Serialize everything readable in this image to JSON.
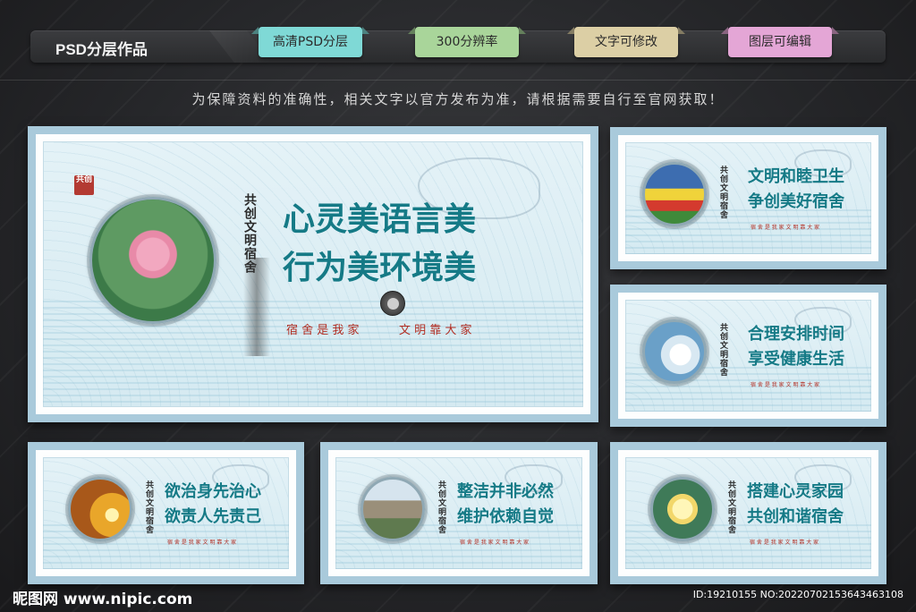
{
  "header": {
    "title": "PSD分层作品",
    "tags": [
      {
        "label": "高清PSD分层",
        "color": "#7fd9d6"
      },
      {
        "label": "300分辨率",
        "color": "#a9d59a"
      },
      {
        "label": "文字可修改",
        "color": "#dccfa5"
      },
      {
        "label": "图层可编辑",
        "color": "#e4a6d6"
      }
    ]
  },
  "notice": "为保障资料的准确性，相关文字以官方发布为准，请根据需要自行至官网获取！",
  "panels": {
    "main": {
      "seal": "共创",
      "vertical": "共创文明宿舍",
      "line1": "心灵美语言美",
      "line2": "行为美环境美",
      "motto_left": "宿 舍 是 我 家",
      "motto_right": "文 明 靠 大 家"
    },
    "p1": {
      "vertical": "共创文明宿舍",
      "line1": "文明和睦卫生",
      "line2": "争创美好宿舍",
      "motto": "宿 舍 是 我 家   文 明 靠 大 家"
    },
    "p2": {
      "vertical": "共创文明宿舍",
      "line1": "合理安排时间",
      "line2": "享受健康生活",
      "motto": "宿 舍 是 我 家   文 明 靠 大 家"
    },
    "p3": {
      "vertical": "共创文明宿舍",
      "line1": "欲治身先治心",
      "line2": "欲责人先责己",
      "motto": "宿 舍 是 我 家   文 明 靠 大 家"
    },
    "p4": {
      "vertical": "共创文明宿舍",
      "line1": "整洁并非必然",
      "line2": "维护依赖自觉",
      "motto": "宿 舍 是 我 家   文 明 靠 大 家"
    },
    "p5": {
      "vertical": "共创文明宿舍",
      "line1": "搭建心灵家园",
      "line2": "共创和谐宿舍",
      "motto": "宿 舍 是 我 家   文 明 靠 大 家"
    }
  },
  "footer": {
    "watermark": "昵图网 www.nipic.com",
    "photo_id": "ID:19210155 NO:20220702153643463108"
  },
  "colors": {
    "slogan": "#157a86",
    "frame": "#a9cadb",
    "motto": "#b22d22"
  }
}
